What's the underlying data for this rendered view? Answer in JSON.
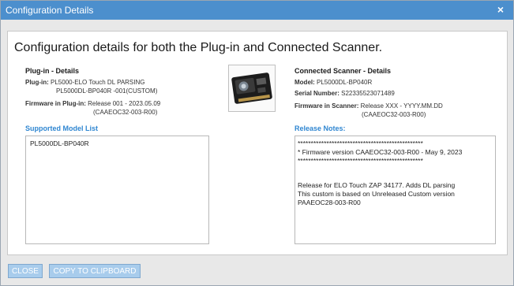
{
  "window": {
    "title": "Configuration Details",
    "close_glyph": "×"
  },
  "headline": "Configuration details for both the Plug-in and Connected Scanner.",
  "plugin": {
    "section_title": "Plug-in - Details",
    "plugin_label": "Plug-in:",
    "plugin_value_line1": "PL5000-ELO Touch DL PARSING",
    "plugin_value_line2": "PL5000DL-BP040R -001(CUSTOM)",
    "firmware_label": "Firmware in Plug-in:",
    "firmware_value_line1": "Release 001 - 2023.05.09",
    "firmware_value_line2": "(CAAEOC32-003-R00)"
  },
  "scanner": {
    "section_title": "Connected Scanner - Details",
    "model_label": "Model:",
    "model_value": "PL5000DL-BP040R",
    "serial_label": "Serial Number:",
    "serial_value": "S22335523071489",
    "firmware_label": "Firmware in Scanner:",
    "firmware_value_line1": "Release XXX - YYYY.MM.DD",
    "firmware_value_line2": "(CAAEOC32-003-R00)"
  },
  "supported_models": {
    "title": "Supported Model List",
    "items": [
      "PL5000DL-BP040R"
    ]
  },
  "release_notes": {
    "title": "Release Notes:",
    "lines": [
      "************************************************",
      "* Firmware version CAAEOC32-003-R00 - May 9, 2023",
      "************************************************",
      "",
      "Release for ELO Touch ZAP 34177. Adds DL parsing",
      "This custom is based on Unreleased Custom version",
      "PAAEOC28-003-R00"
    ]
  },
  "buttons": {
    "close": "CLOSE",
    "copy": "COPY TO CLIPBOARD"
  },
  "colors": {
    "titlebar": "#4c8fcd",
    "accent_text": "#2f86d1",
    "button": "#a8ccec"
  }
}
